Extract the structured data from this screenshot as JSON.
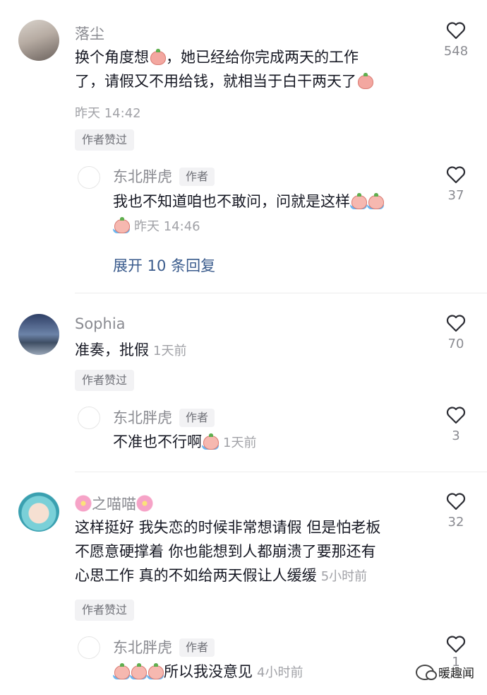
{
  "comments": [
    {
      "author": "落尘",
      "text_1": "换个角度想",
      "text_2": "，她已经给你完成两天的工作",
      "text_3": "了，请假又不用给钱，就相当于白干两天了",
      "time": "昨天 14:42",
      "likes": "548",
      "badge": "作者赞过",
      "reply": {
        "author": "东北胖虎",
        "author_tag": "作者",
        "text": "我也不知道咱也不敢问，问就是这样",
        "time": "昨天 14:46",
        "likes": "37",
        "expand": "展开 10 条回复"
      }
    },
    {
      "author": "Sophia",
      "text": "准奏，批假",
      "time": "1天前",
      "likes": "70",
      "badge": "作者赞过",
      "reply": {
        "author": "东北胖虎",
        "author_tag": "作者",
        "text": "不准也不行啊",
        "time": "1天前",
        "likes": "3"
      }
    },
    {
      "author": "之喵喵",
      "text_1": "这样挺好 我失恋的时候非常想请假 但是怕老板",
      "text_2": "不愿意硬撑着 你也能想到人都崩溃了要那还有",
      "text_3": "心思工作 真的不如给两天假让人缓缓",
      "time": "5小时前",
      "likes": "32",
      "badge": "作者赞过",
      "reply": {
        "author": "东北胖虎",
        "author_tag": "作者",
        "text": "所以我没意见",
        "time": "4小时前",
        "likes": "1"
      }
    }
  ],
  "watermark": "暖趣闻",
  "colors": {
    "text": "#161823",
    "muted": "#8a8b91",
    "link": "#3a5b8c"
  }
}
